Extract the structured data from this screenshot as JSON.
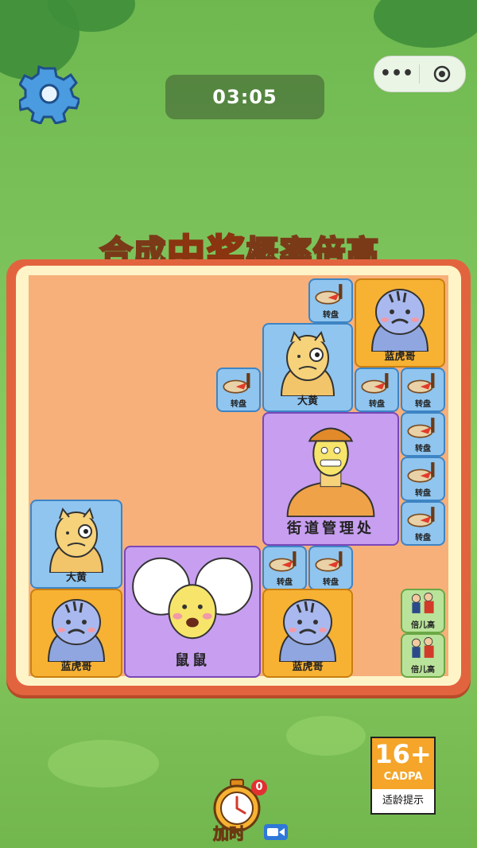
{
  "timer": "03:05",
  "capsule": {
    "more": "•••",
    "record_icon": "record-icon"
  },
  "banner": {
    "part1": "合成",
    "part2": "中奖",
    "part3": "概率倍高"
  },
  "tiles": {
    "zhuanpan": "转盘",
    "lanhuge": "蓝虎哥",
    "dahuang": "大黄",
    "jiedao": "街道管理处",
    "shushu": "鼠鼠",
    "beiergao": "倍儿高"
  },
  "bottom": {
    "add_time": "加时",
    "badge": "0"
  },
  "age_rating": {
    "number": "16+",
    "org": "CADPA",
    "note": "适龄提示"
  },
  "colors": {
    "board_border": "#e2643e",
    "play_area": "#f7b07a",
    "timer_bg": "#3c5a32"
  }
}
